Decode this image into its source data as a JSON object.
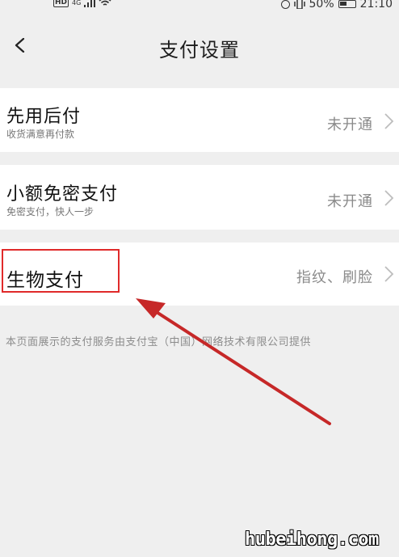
{
  "status_bar": {
    "hd": "HD",
    "network": "4G",
    "battery": "50%",
    "time": "21:10"
  },
  "header": {
    "title": "支付设置",
    "back_icon": "chevron-left-icon"
  },
  "settings": [
    {
      "title": "先用后付",
      "subtitle": "收货满意再付款",
      "status": "未开通"
    },
    {
      "title": "小额免密支付",
      "subtitle": "免密支付，快人一步",
      "status": "未开通"
    },
    {
      "title": "生物支付",
      "subtitle": "",
      "status": "指纹、刷脸"
    }
  ],
  "footer_note": "本页面展示的支付服务由支付宝（中国）网络技术有限公司提供",
  "annotation": {
    "highlight_color": "#e02a2a",
    "arrow_color": "#c62828"
  },
  "watermark": "hubeihong.com"
}
